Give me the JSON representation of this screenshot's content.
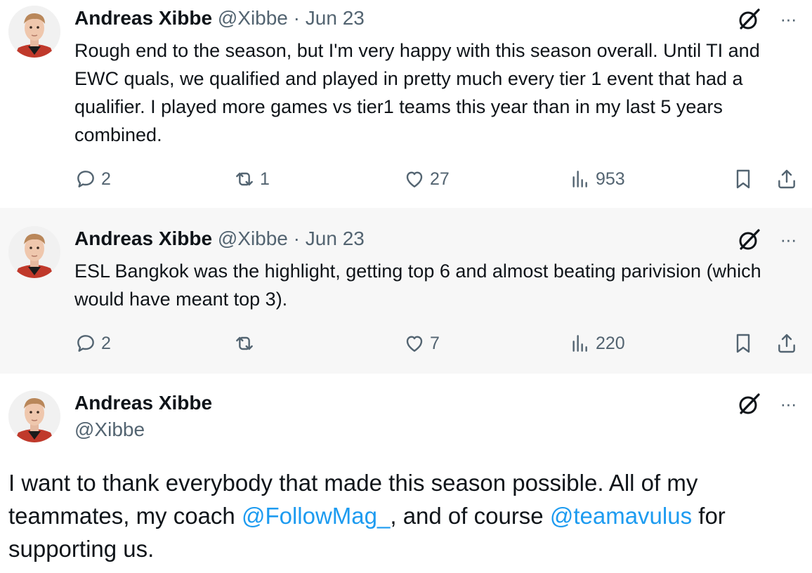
{
  "tweets": [
    {
      "name": "Andreas Xibbe",
      "handle": "@Xibbe",
      "dot": "·",
      "date": "Jun 23",
      "text": "Rough end to the season, but I'm very happy with this season overall. Until TI and EWC quals, we qualified and played in pretty much every tier 1 event that had a qualifier. I played more games vs tier1 teams this year than in my last 5 years combined.",
      "stats": {
        "replies": "2",
        "reposts": "1",
        "likes": "27",
        "views": "953"
      }
    },
    {
      "name": "Andreas Xibbe",
      "handle": "@Xibbe",
      "dot": "·",
      "date": "Jun 23",
      "text": "ESL Bangkok was the highlight, getting top 6 and almost beating parivision (which would have meant top 3).",
      "stats": {
        "replies": "2",
        "reposts": "",
        "likes": "7",
        "views": "220"
      }
    },
    {
      "name": "Andreas Xibbe",
      "handle": "@Xibbe",
      "text_parts": {
        "p1": "I want to thank everybody that made this season possible. All of my teammates, my coach ",
        "mention1": "@FollowMag_",
        "p2": ", and of course ",
        "mention2": "@teamavulus",
        "p3": " for supporting us."
      }
    }
  ],
  "more_label": "···",
  "icons": [
    "reply-icon",
    "repost-icon",
    "like-icon",
    "views-icon",
    "bookmark-icon",
    "share-icon",
    "grok-icon",
    "more-icon"
  ],
  "colors": {
    "text": "#0f1419",
    "secondary": "#536471",
    "link": "#1d9bf0",
    "highlight_bg": "#f7f7f7",
    "thread_line": "#cfd9de"
  }
}
